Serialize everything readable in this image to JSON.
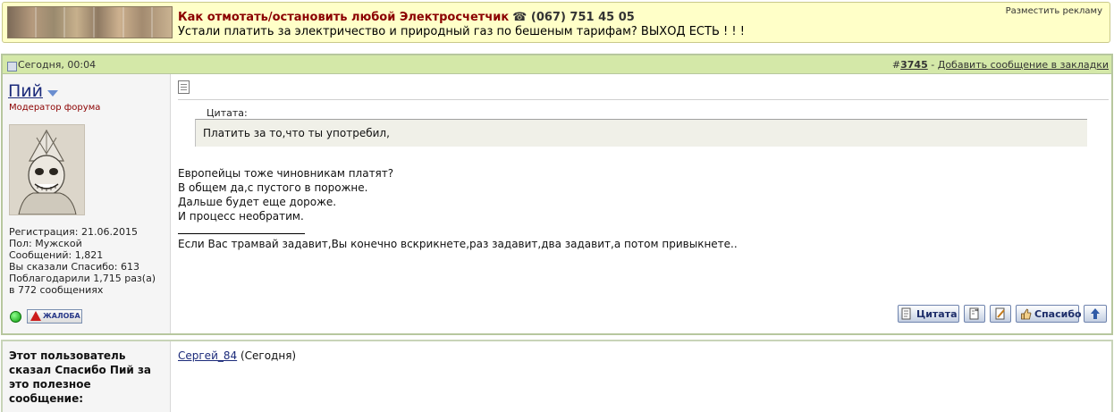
{
  "ad": {
    "title": "Как отмотать/остановить любой Электросчетчик",
    "phone": "☎ (067) 751 45 05",
    "text": "Устали платить за электричество и природный газ по бешеным тарифам? ВЫХОД ЕСТЬ ! ! !",
    "place_ad_link": "Разместить рекламу"
  },
  "post": {
    "date": "Сегодня, 00:04",
    "number_prefix": "#",
    "number": "3745",
    "bookmark_sep": " - ",
    "bookmark_link": "Добавить сообщение в закладки",
    "author": {
      "name": "Пий",
      "title": "Модератор форума",
      "registration": "Регистрация: 21.06.2015",
      "gender": "Пол: Мужской",
      "messages": "Сообщений: 1,821",
      "thanked": "Вы сказали Спасибо: 613",
      "thanked_by": "Поблагодарили 1,715 раз(а)",
      "thanked_in": "в 772 сообщениях",
      "report_label": "ЖАЛОБА"
    },
    "quote_label": "Цитата:",
    "quote_text": "Платить за то,что ты употребил,",
    "message_lines": [
      "Европейцы тоже чиновникам платят?",
      "В общем да,с пустого в порожне.",
      "Дальше будет еще дороже.",
      "И процесс необратим."
    ],
    "signature": "Если Вас трамвай задавит,Вы конечно вскрикнете,раз задавит,два задавит,а потом привыкнете..",
    "buttons": {
      "quote": "Цитата",
      "thanks": "Спасибо"
    }
  },
  "thanks_box": {
    "label": "Этот пользователь сказал Спасибо Пий за это полезное сообщение:",
    "user": "Сергей_84",
    "when": "(Сегодня)"
  },
  "colors": {
    "post_header": "#d4e8a8",
    "ad_background": "#ffffc8",
    "link": "#1b2a7a",
    "moderator_title": "#8b0000"
  }
}
